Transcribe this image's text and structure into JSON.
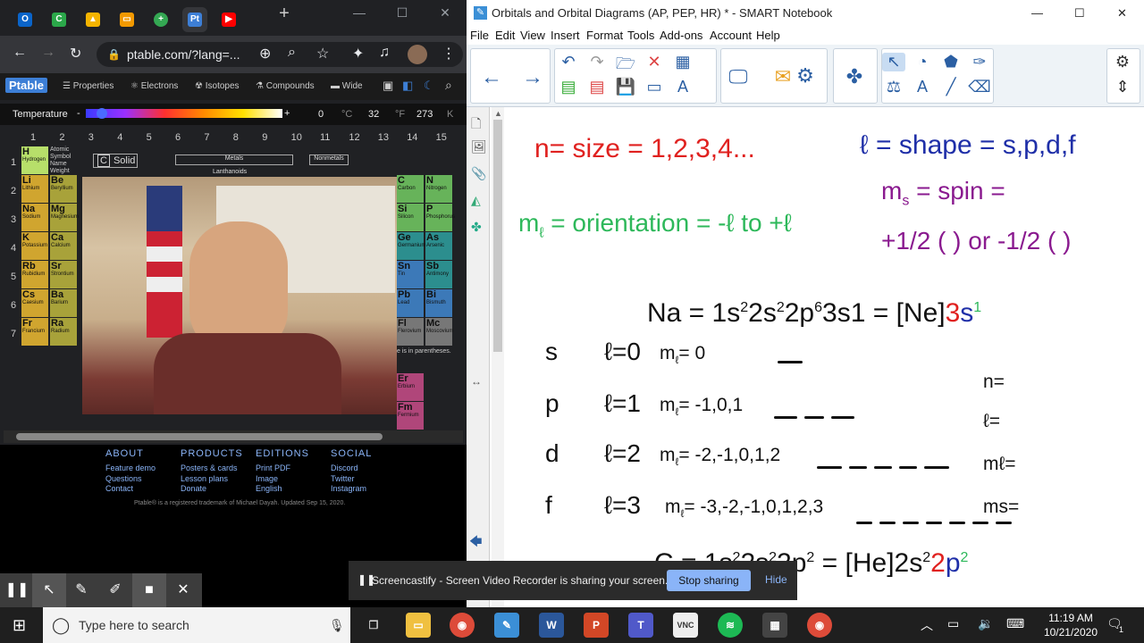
{
  "chrome": {
    "url": "ptable.com/?lang=...",
    "tabs": [
      "Outlook",
      "Classroom",
      "Drive",
      "Slides",
      "Jamboard",
      "Ptable",
      "YouTube"
    ],
    "new_tab": "+"
  },
  "ptable": {
    "logo": "Ptable",
    "nav": [
      "Properties",
      "Electrons",
      "Isotopes",
      "Compounds",
      "Wide"
    ],
    "temp_label": "Temperature",
    "temp_c": "0",
    "temp_c_unit": "°C",
    "temp_f": "32",
    "temp_f_unit": "°F",
    "temp_k": "273",
    "temp_k_unit": "K",
    "groups": [
      "1",
      "2",
      "3",
      "4",
      "5",
      "6",
      "7",
      "8",
      "9",
      "10",
      "11",
      "12",
      "13",
      "14",
      "15"
    ],
    "periods": [
      "1",
      "2",
      "3",
      "4",
      "5",
      "6",
      "7"
    ],
    "solid": "Solid",
    "metals": "Metals",
    "nonmetals": "Nonmetals",
    "lanthanoids": "Lanthanoids",
    "legend_lines": [
      "Atomic",
      "Symbol",
      "Name",
      "Weight"
    ],
    "note": "e is in parentheses.",
    "left_elements": [
      {
        "s": "H",
        "n": "Hydrogen",
        "c": "#b7df6a"
      },
      {
        "s": "Li",
        "n": "Lithium",
        "c": "#d0a52f"
      },
      {
        "s": "Na",
        "n": "Sodium",
        "c": "#d0a52f"
      },
      {
        "s": "K",
        "n": "Potassium",
        "c": "#d0a52f"
      },
      {
        "s": "Rb",
        "n": "Rubidium",
        "c": "#d0a52f"
      },
      {
        "s": "Cs",
        "n": "Caesium",
        "c": "#d0a52f"
      },
      {
        "s": "Fr",
        "n": "Francium",
        "c": "#d0a52f"
      }
    ],
    "col2_elements": [
      {
        "s": "Be",
        "n": "Beryllium"
      },
      {
        "s": "Mg",
        "n": "Magnesium"
      },
      {
        "s": "Ca",
        "n": "Calcium"
      },
      {
        "s": "Sr",
        "n": "Strontium"
      },
      {
        "s": "Ba",
        "n": "Barium"
      },
      {
        "s": "Ra",
        "n": "Radium"
      }
    ],
    "right_elements": [
      {
        "s": "C",
        "n": "Carbon",
        "c": "#67b35a"
      },
      {
        "s": "Si",
        "n": "Silicon",
        "c": "#67b35a"
      },
      {
        "s": "Ge",
        "n": "Germanium",
        "c": "#2c8e8e"
      },
      {
        "s": "Sn",
        "n": "Tin",
        "c": "#3c79b8"
      },
      {
        "s": "Pb",
        "n": "Lead",
        "c": "#3c79b8"
      },
      {
        "s": "Fl",
        "n": "Flerovium",
        "c": "#777"
      }
    ],
    "right2_elements": [
      {
        "s": "N",
        "n": "Nitrogen",
        "c": "#67b35a"
      },
      {
        "s": "P",
        "n": "Phosphorus",
        "c": "#67b35a"
      },
      {
        "s": "As",
        "n": "Arsenic",
        "c": "#2c8e8e"
      },
      {
        "s": "Sb",
        "n": "Antimony",
        "c": "#2c8e8e"
      },
      {
        "s": "Bi",
        "n": "Bismuth",
        "c": "#3c79b8"
      },
      {
        "s": "Mc",
        "n": "Moscovium",
        "c": "#777"
      }
    ],
    "fblock": [
      {
        "s": "Er",
        "n": "Erbium",
        "c": "#b0467a"
      },
      {
        "s": "Fm",
        "n": "Fermium",
        "c": "#b0467a"
      }
    ],
    "footer": {
      "cols": [
        {
          "h": "ABOUT",
          "items": [
            "Feature demo",
            "Questions",
            "Contact"
          ]
        },
        {
          "h": "PRODUCTS",
          "items": [
            "Posters & cards",
            "Lesson plans",
            "Donate"
          ]
        },
        {
          "h": "EDITIONS",
          "items": [
            "Print PDF",
            "Image",
            "English"
          ]
        },
        {
          "h": "SOCIAL",
          "items": [
            "Discord",
            "Twitter",
            "Instagram"
          ]
        }
      ],
      "copyright": "Ptable® is a registered trademark of Michael Dayah. Updated Sep 15, 2020."
    }
  },
  "notebook": {
    "title": "Orbitals and Orbital Diagrams (AP, PEP, HR) * - SMART Notebook",
    "menu": [
      "File",
      "Edit",
      "View",
      "Insert",
      "Format",
      "Tools",
      "Add-ons",
      "Account",
      "Help"
    ],
    "line1": "n= size = 1,2,3,4...",
    "line2_pre": "ℓ = shape = s,p,d,f",
    "ms_line": "m",
    "ms_sub": "s",
    "ms_rest": " = spin =",
    "spin_vals": "+1/2 ( ) or -1/2 ( )",
    "orient_pre": "m",
    "orient_sub": "ℓ",
    "orient_rest": " = orientation = -ℓ to +ℓ",
    "na_eq": "Na = 1s",
    "na_rest": [
      "2",
      "2s",
      "2",
      "2p",
      "6",
      "3s",
      "1",
      " = [Ne]"
    ],
    "na_red": "3",
    "na_blue": "s",
    "na_sup": "1",
    "rows": [
      {
        "orb": "s",
        "l": "ℓ=0",
        "ml": "m",
        "mlsub": "ℓ",
        "mlv": "= 0",
        "dashes": 1
      },
      {
        "orb": "p",
        "l": "ℓ=1",
        "ml": "m",
        "mlsub": "ℓ",
        "mlv": "= -1,0,1",
        "dashes": 3
      },
      {
        "orb": "d",
        "l": "ℓ=2",
        "ml": "m",
        "mlsub": "ℓ",
        "mlv": "= -2,-1,0,1,2",
        "dashes": 5
      },
      {
        "orb": "f",
        "l": "ℓ=3",
        "ml": "m",
        "mlsub": "ℓ",
        "mlv": "= -3,-2,-1,0,1,2,3",
        "dashes": 7
      }
    ],
    "right_labels": [
      "n=",
      "ℓ=",
      "mℓ=",
      "ms="
    ],
    "c_eq": "C = 1s",
    "c_tail": " = [He]2s",
    "c_red": "2",
    "c_blue": "p",
    "c_sup": "2",
    "bottom_partial": "s   ℓ=0   mℓ = 0"
  },
  "screencastify": {
    "message": "Screencastify - Screen Video Recorder is sharing your screen.",
    "stop": "Stop sharing",
    "hide": "Hide"
  },
  "taskbar": {
    "search": "Type here to search",
    "time": "11:19 AM",
    "date": "10/21/2020",
    "notif": "1"
  }
}
